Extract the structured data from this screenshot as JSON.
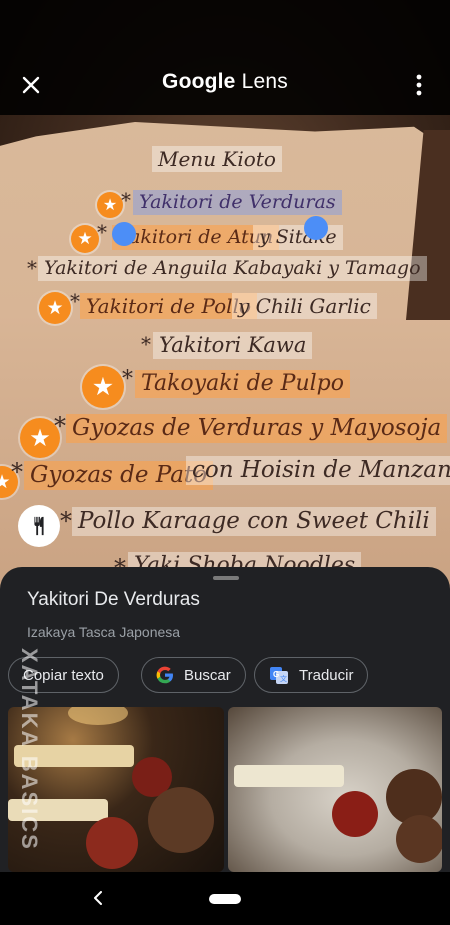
{
  "app": {
    "title_google": "Google",
    "title_lens": "Lens"
  },
  "menu": {
    "header": "Menu Kioto",
    "lines": [
      {
        "text": "Yakitori de Verduras"
      },
      {
        "text_hl": "Yakitori de Atun",
        "text_rest": "y Sitake"
      },
      {
        "text": "Yakitori de Anguila Kabayaki y Tamago"
      },
      {
        "text_hl": "Yakitori de Pollo",
        "text_rest": "y Chili Garlic"
      },
      {
        "text": "Yakitori Kawa"
      },
      {
        "text": "Takoyaki de Pulpo"
      },
      {
        "text": "Gyozas de Verduras y Mayosoja"
      },
      {
        "text_hl": "Gyozas de Pato",
        "text_rest": "con Hoisin de Manzana"
      },
      {
        "text": "Pollo Karaage con Sweet Chili"
      },
      {
        "text": "Yaki Shoba Noodles"
      }
    ],
    "bullet": "*"
  },
  "sheet": {
    "title": "Yakitori De Verduras",
    "subtitle": "Izakaya Tasca Japonesa",
    "actions": [
      {
        "label": "Copiar texto"
      },
      {
        "label": "Buscar"
      },
      {
        "label": "Traducir"
      }
    ]
  },
  "watermark": "XATAKA BASICS",
  "colors": {
    "accent_orange": "#f68c1e",
    "handle_blue": "#4c8ef7",
    "sheet_bg": "#202124"
  }
}
